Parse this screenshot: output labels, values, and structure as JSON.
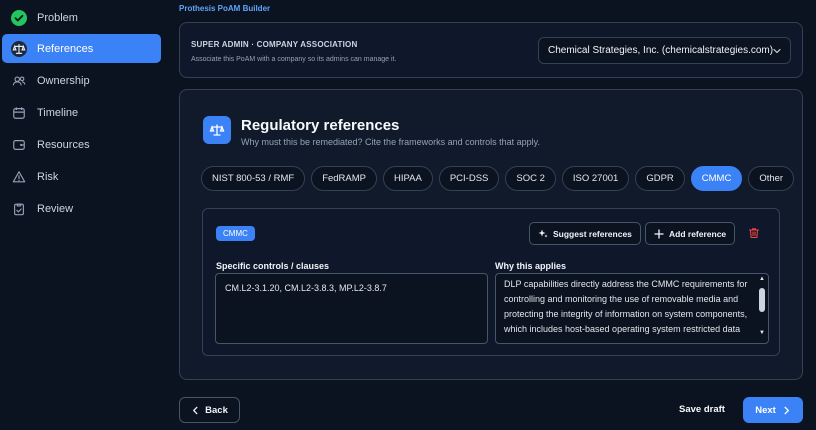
{
  "brand": "Prothesis PoAM Builder",
  "colors": {
    "accent": "#3b82f6",
    "success": "#22c55e",
    "danger": "#ef4444",
    "background": "#0b1220"
  },
  "sidebar": {
    "items": [
      {
        "label": "Problem",
        "icon": "check-circle-icon",
        "state": "done"
      },
      {
        "label": "References",
        "icon": "scale-icon",
        "state": "active"
      },
      {
        "label": "Ownership",
        "icon": "users-icon",
        "state": "default"
      },
      {
        "label": "Timeline",
        "icon": "calendar-icon",
        "state": "default"
      },
      {
        "label": "Resources",
        "icon": "wallet-icon",
        "state": "default"
      },
      {
        "label": "Risk",
        "icon": "warning-triangle-icon",
        "state": "default"
      },
      {
        "label": "Review",
        "icon": "clipboard-check-icon",
        "state": "default"
      }
    ]
  },
  "company": {
    "title": "SUPER ADMIN · COMPANY ASSOCIATION",
    "subtitle": "Associate this PoAM with a company so its admins can manage it.",
    "selected": "Chemical Strategies, Inc. (chemicalstrategies.com)"
  },
  "section": {
    "icon": "scale-icon",
    "title": "Regulatory references",
    "subtitle": "Why must this be remediated? Cite the frameworks and controls that apply."
  },
  "frameworks": [
    {
      "label": "NIST 800-53 / RMF",
      "selected": false
    },
    {
      "label": "FedRAMP",
      "selected": false
    },
    {
      "label": "HIPAA",
      "selected": false
    },
    {
      "label": "PCI-DSS",
      "selected": false
    },
    {
      "label": "SOC 2",
      "selected": false
    },
    {
      "label": "ISO 27001",
      "selected": false
    },
    {
      "label": "GDPR",
      "selected": false
    },
    {
      "label": "CMMC",
      "selected": true
    },
    {
      "label": "Other",
      "selected": false
    }
  ],
  "reference": {
    "badge": "CMMC",
    "suggest_label": "Suggest references",
    "add_label": "Add reference",
    "controls_label": "Specific controls / clauses",
    "controls_value": "CM.L2-3.1.20, CM.L2-3.8.3, MP.L2-3.8.7",
    "why_label": "Why this applies",
    "why_value": "DLP capabilities directly address the CMMC requirements for controlling and monitoring the use of removable media and protecting the integrity of information on system components, which includes host-based operating system restricted data"
  },
  "footer": {
    "back_label": "Back",
    "save_label": "Save draft",
    "next_label": "Next"
  }
}
